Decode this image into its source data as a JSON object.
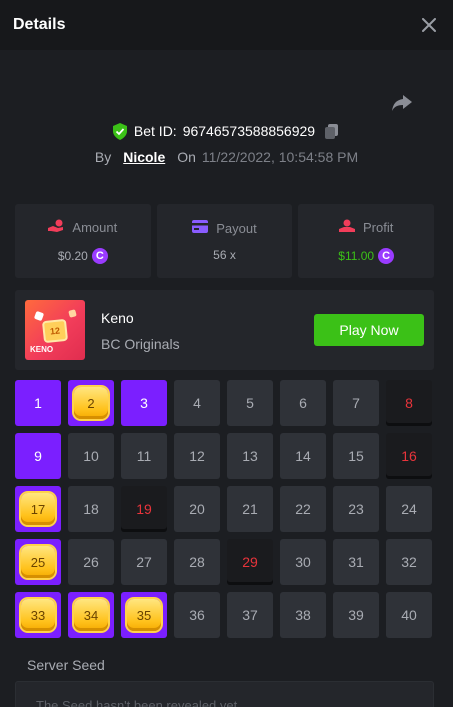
{
  "header": {
    "title": "Details"
  },
  "bet": {
    "id_label": "Bet ID:",
    "id_value": "96746573588856929",
    "by_label": "By",
    "user": "Nicole",
    "on_label": "On",
    "datetime": "11/22/2022, 10:54:58 PM"
  },
  "stats": {
    "amount": {
      "label": "Amount",
      "value": "$0.20"
    },
    "payout": {
      "label": "Payout",
      "value": "56 x"
    },
    "profit": {
      "label": "Profit",
      "value": "$11.00"
    }
  },
  "currency_symbol": "C",
  "game": {
    "name": "Keno",
    "provider": "BC Originals",
    "thumb_label": "KENO",
    "thumb_number": "12",
    "play_label": "Play Now"
  },
  "board": {
    "cells": [
      {
        "n": "1",
        "state": "picked"
      },
      {
        "n": "2",
        "state": "hit"
      },
      {
        "n": "3",
        "state": "picked"
      },
      {
        "n": "4",
        "state": "none"
      },
      {
        "n": "5",
        "state": "none"
      },
      {
        "n": "6",
        "state": "none"
      },
      {
        "n": "7",
        "state": "none"
      },
      {
        "n": "8",
        "state": "miss"
      },
      {
        "n": "9",
        "state": "picked"
      },
      {
        "n": "10",
        "state": "none"
      },
      {
        "n": "11",
        "state": "none"
      },
      {
        "n": "12",
        "state": "none"
      },
      {
        "n": "13",
        "state": "none"
      },
      {
        "n": "14",
        "state": "none"
      },
      {
        "n": "15",
        "state": "none"
      },
      {
        "n": "16",
        "state": "miss"
      },
      {
        "n": "17",
        "state": "hit"
      },
      {
        "n": "18",
        "state": "none"
      },
      {
        "n": "19",
        "state": "miss"
      },
      {
        "n": "20",
        "state": "none"
      },
      {
        "n": "21",
        "state": "none"
      },
      {
        "n": "22",
        "state": "none"
      },
      {
        "n": "23",
        "state": "none"
      },
      {
        "n": "24",
        "state": "none"
      },
      {
        "n": "25",
        "state": "hit"
      },
      {
        "n": "26",
        "state": "none"
      },
      {
        "n": "27",
        "state": "none"
      },
      {
        "n": "28",
        "state": "none"
      },
      {
        "n": "29",
        "state": "miss"
      },
      {
        "n": "30",
        "state": "none"
      },
      {
        "n": "31",
        "state": "none"
      },
      {
        "n": "32",
        "state": "none"
      },
      {
        "n": "33",
        "state": "hit"
      },
      {
        "n": "34",
        "state": "hit"
      },
      {
        "n": "35",
        "state": "hit"
      },
      {
        "n": "36",
        "state": "none"
      },
      {
        "n": "37",
        "state": "none"
      },
      {
        "n": "38",
        "state": "none"
      },
      {
        "n": "39",
        "state": "none"
      },
      {
        "n": "40",
        "state": "none"
      }
    ]
  },
  "seed": {
    "label": "Server Seed",
    "text": "The Seed hasn't been revealed yet"
  },
  "colors": {
    "accent_purple": "#7b1fff",
    "play_green": "#3bc117",
    "miss_red": "#e8343b",
    "profit_green": "#3bc117"
  },
  "icons": {
    "close": "close-icon",
    "share": "share-icon",
    "shield": "shield-check-icon",
    "copy": "copy-icon",
    "amount": "coins-hand-icon",
    "payout": "card-icon",
    "profit": "profit-icon",
    "coin": "coin-icon"
  }
}
